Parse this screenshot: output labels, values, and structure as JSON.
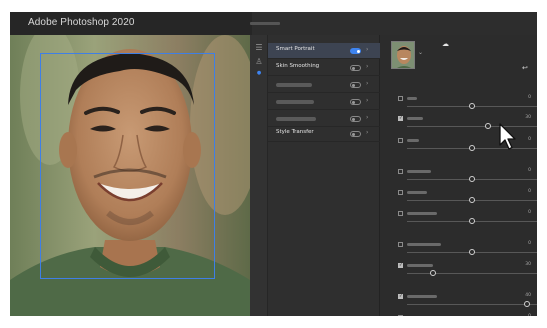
{
  "app": {
    "title": "Adobe Photoshop 2020"
  },
  "colors": {
    "accent": "#3e84f0",
    "selection": "#3f7fe6"
  },
  "filters": [
    {
      "label": "Smart Portrait",
      "on": true,
      "active": true
    },
    {
      "label": "Skin Smoothing",
      "on": false,
      "active": false
    },
    {
      "label": "",
      "on": false,
      "active": false
    },
    {
      "label": "",
      "on": false,
      "active": false
    },
    {
      "label": "",
      "on": false,
      "active": false
    },
    {
      "label": "Style Transfer",
      "on": false,
      "active": false
    }
  ],
  "panel": {
    "thumbnail_icon": "portrait-thumbnail",
    "menu_icon": "chevron-down-icon",
    "cloud_icon": "cloud-icon",
    "reset_icon": "reset-icon"
  },
  "params": [
    {
      "checked": false,
      "value": "0",
      "level": 0.5
    },
    {
      "checked": true,
      "value": "30",
      "level": 0.62
    },
    {
      "checked": false,
      "value": "0",
      "level": 0.5
    },
    {
      "checked": false,
      "value": "0",
      "level": 0.5
    },
    {
      "checked": false,
      "value": "0",
      "level": 0.5
    },
    {
      "checked": false,
      "value": "0",
      "level": 0.5
    },
    {
      "checked": false,
      "value": "0",
      "level": 0.5
    },
    {
      "checked": true,
      "value": "30",
      "level": 0.2
    },
    {
      "checked": true,
      "value": "40",
      "level": 0.92
    },
    {
      "checked": false,
      "value": "0",
      "level": 0.5
    }
  ]
}
